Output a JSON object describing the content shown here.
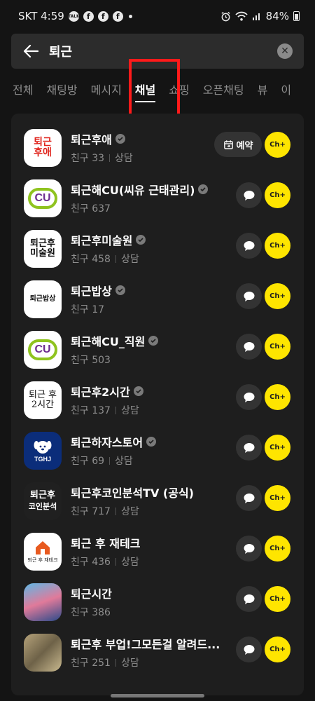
{
  "status_bar": {
    "carrier_time": "SKT 4:59",
    "talk_badge": "TALK",
    "fb_glyph": "f",
    "battery": "84%"
  },
  "search": {
    "query": "퇴근"
  },
  "tabs": [
    "전체",
    "채팅방",
    "메시지",
    "채널",
    "쇼핑",
    "오픈채팅",
    "뷰",
    "이"
  ],
  "active_tab": "채널",
  "buttons": {
    "reserve_label": "예약",
    "ch_label": "Ch+"
  },
  "channels": [
    {
      "name": "퇴근후애",
      "verified": true,
      "friends": "친구 33",
      "consult": "상담",
      "action": "reserve",
      "logo": [
        "퇴근",
        "후애"
      ]
    },
    {
      "name": "퇴근해CU(씨유 근태관리)",
      "verified": true,
      "friends": "친구 637",
      "consult": "",
      "action": "chat",
      "logo": [
        "CU"
      ]
    },
    {
      "name": "퇴근후미술원",
      "verified": true,
      "friends": "친구 458",
      "consult": "상담",
      "action": "chat",
      "logo": [
        "퇴근후",
        "미술원"
      ]
    },
    {
      "name": "퇴근밥상",
      "verified": true,
      "friends": "친구 17",
      "consult": "",
      "action": "chat",
      "logo": [
        "퇴근밥상"
      ]
    },
    {
      "name": "퇴근해CU_직원",
      "verified": true,
      "friends": "친구 503",
      "consult": "",
      "action": "chat",
      "logo": [
        "CU"
      ]
    },
    {
      "name": "퇴근후2시간",
      "verified": true,
      "friends": "친구 137",
      "consult": "상담",
      "action": "chat",
      "logo": [
        "퇴근 후",
        "2시간"
      ]
    },
    {
      "name": "퇴근하자스토어",
      "verified": true,
      "friends": "친구 69",
      "consult": "상담",
      "action": "chat",
      "logo": [
        "TGHJ"
      ]
    },
    {
      "name": "퇴근후코인분석TV (공식)",
      "verified": false,
      "friends": "친구 717",
      "consult": "상담",
      "action": "chat",
      "logo": [
        "퇴근후",
        "코인분석"
      ]
    },
    {
      "name": "퇴근 후 재테크",
      "verified": false,
      "friends": "친구 436",
      "consult": "상담",
      "action": "chat",
      "logo": [
        "퇴근 후 재테크"
      ]
    },
    {
      "name": "퇴근시간",
      "verified": false,
      "friends": "친구 386",
      "consult": "",
      "action": "chat",
      "logo": []
    },
    {
      "name": "퇴근후 부업!그모든걸 알려드...",
      "verified": false,
      "friends": "친구 251",
      "consult": "상담",
      "action": "chat",
      "logo": []
    }
  ],
  "colors": {
    "accent_yellow": "#fee500",
    "highlight_red": "#ff1a1a",
    "background": "#141414",
    "card": "#1e1e1e"
  }
}
